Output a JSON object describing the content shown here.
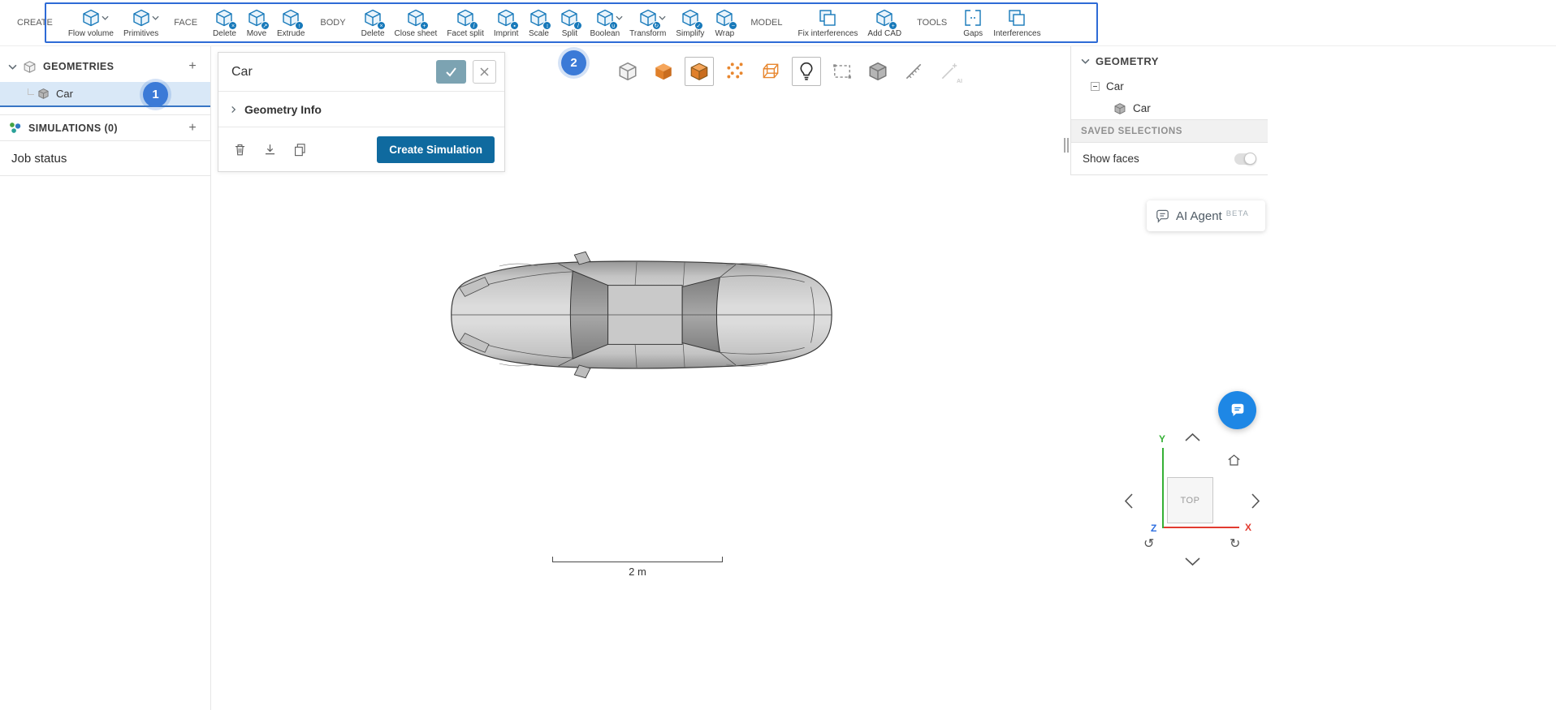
{
  "colors": {
    "icon_blue": "#1779ba",
    "annotation_blue": "#2e6bd6",
    "primary_button_blue": "#0f6a9f",
    "selection_orange": "#e8872f",
    "selected_row_blue": "#d9e8f7",
    "chat_bubble_blue": "#1e87e5",
    "axis_x_red": "#e23b30",
    "axis_y_green": "#36b036",
    "axis_z_blue": "#2f6fe0"
  },
  "toolbar": {
    "create_label": "CREATE",
    "face_label": "FACE",
    "body_label": "BODY",
    "model_label": "MODEL",
    "tools_label": "TOOLS",
    "tools": {
      "flow_volume": "Flow volume",
      "primitives": "Primitives",
      "face_delete": "Delete",
      "move": "Move",
      "extrude": "Extrude",
      "body_delete": "Delete",
      "close_sheet": "Close sheet",
      "facet_split": "Facet split",
      "imprint": "Imprint",
      "scale": "Scale",
      "split": "Split",
      "boolean": "Boolean",
      "transform": "Transform",
      "simplify": "Simplify",
      "wrap": "Wrap",
      "fix_interferences": "Fix interferences",
      "add_cad": "Add CAD",
      "gaps": "Gaps",
      "interferences": "Interferences"
    },
    "badges": {
      "face_delete": "×",
      "move": "↗",
      "extrude": "↑",
      "body_delete": "×",
      "close_sheet": "+",
      "facet_split": "/",
      "imprint": "▪",
      "scale": "↕",
      "split": "/",
      "boolean": "∪",
      "transform": "↻",
      "simplify": "✓",
      "wrap": "~",
      "add_cad": "+"
    }
  },
  "annotations": {
    "step1": "1",
    "step2": "2"
  },
  "sidebar": {
    "geometries_label": "GEOMETRIES",
    "geometries_add": "+",
    "car_item": "Car",
    "simulations_label": "SIMULATIONS (0)",
    "simulations_add": "+",
    "job_status": "Job status"
  },
  "detail_panel": {
    "title": "Car",
    "geometry_info": "Geometry Info",
    "create_simulation": "Create Simulation"
  },
  "view_toolbar": {
    "ai_label": "AI",
    "icons": [
      "transparent-view",
      "shaded-view",
      "shaded-edges-view",
      "vertices-view",
      "wireframe-view",
      "lighting",
      "box-select",
      "solid-body-select",
      "measure",
      "ai-select"
    ]
  },
  "right_panel": {
    "header": "GEOMETRY",
    "tree_root": "Car",
    "tree_child": "Car",
    "saved_selections": "SAVED SELECTIONS",
    "show_faces": "Show faces"
  },
  "ai_agent": {
    "label": "AI Agent",
    "beta": "BETA"
  },
  "viewport": {
    "scale_label": "2 m"
  },
  "nav_cube": {
    "face": "TOP",
    "axis_x": "X",
    "axis_y": "Y",
    "axis_z": "Z"
  }
}
